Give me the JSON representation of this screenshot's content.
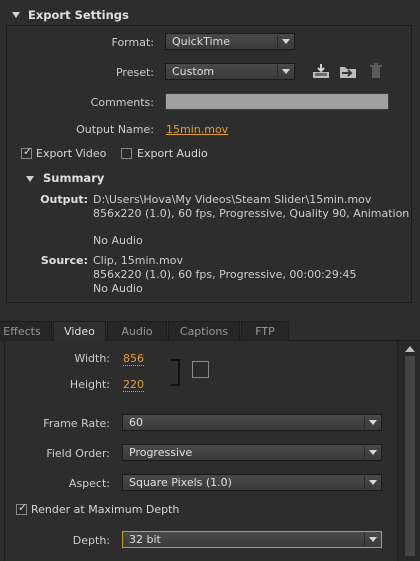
{
  "export_settings": {
    "title": "Export Settings",
    "format_label": "Format:",
    "format_value": "QuickTime",
    "preset_label": "Preset:",
    "preset_value": "Custom",
    "comments_label": "Comments:",
    "comments_value": "",
    "output_name_label": "Output Name:",
    "output_name_value": "15min.mov",
    "export_video_label": "Export Video",
    "export_video_checked": true,
    "export_audio_label": "Export Audio",
    "export_audio_checked": false
  },
  "summary": {
    "title": "Summary",
    "output_label": "Output:",
    "output_lines": [
      "D:\\Users\\Hova\\My Videos\\Steam Slider\\15min.mov",
      "856x220 (1.0), 60 fps, Progressive, Quality 90, Animation",
      "",
      "No Audio"
    ],
    "source_label": "Source:",
    "source_lines": [
      "Clip, 15min.mov",
      "856x220 (1.0), 60 fps, Progressive, 00:00:29:45",
      "No Audio"
    ]
  },
  "tabs": [
    "Effects",
    "Video",
    "Audio",
    "Captions",
    "FTP"
  ],
  "active_tab": "Video",
  "video": {
    "width_label": "Width:",
    "width_value": "856",
    "height_label": "Height:",
    "height_value": "220",
    "frame_rate_label": "Frame Rate:",
    "frame_rate_value": "60",
    "field_order_label": "Field Order:",
    "field_order_value": "Progressive",
    "aspect_label": "Aspect:",
    "aspect_value": "Square Pixels (1.0)",
    "render_max_depth_label": "Render at Maximum Depth",
    "render_max_depth_checked": true,
    "depth_label": "Depth:",
    "depth_value": "32 bit"
  },
  "icons": [
    "save-preset-icon",
    "import-preset-icon",
    "delete-preset-icon",
    "constrain-proportions-icon"
  ],
  "colors": {
    "accent": "#e0a03a",
    "background": "#2d2d2d",
    "focus_border": "#c69a2e"
  }
}
